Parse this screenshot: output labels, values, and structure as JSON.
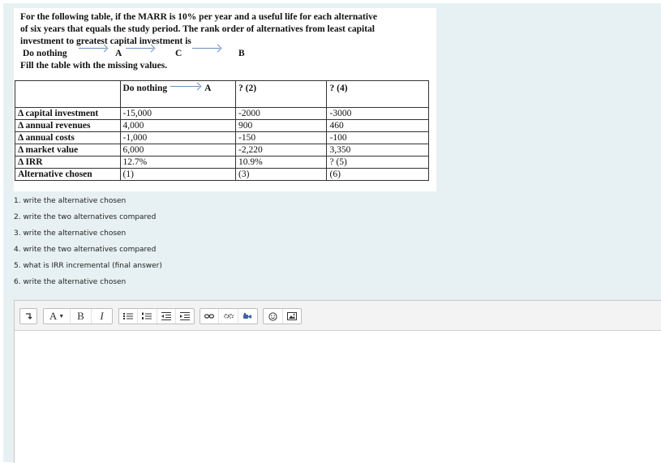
{
  "question": {
    "line1": "For the following table, if the MARR is 10% per year and a useful life for each alternative",
    "line2": "of six years that equals the study period. The rank order of alternatives from least capital",
    "line3": "investment to greatest capital investment is",
    "rank": [
      "Do nothing",
      "A",
      "C",
      "B"
    ],
    "instruction": "Fill the table with the missing values."
  },
  "table": {
    "header": {
      "col1_left": "Do nothing",
      "col1_right": "A",
      "col2": "? (2)",
      "col3": "? (4)"
    },
    "rows": [
      {
        "label": "Δ capital investment",
        "c1": "-15,000",
        "c2": "-2000",
        "c3": "-3000"
      },
      {
        "label": "Δ annual  revenues",
        "c1": "4,000",
        "c2": "900",
        "c3": "460"
      },
      {
        "label": "Δ annual costs",
        "c1": "-1,000",
        "c2": "-150",
        "c3": "-100"
      },
      {
        "label": "Δ market value",
        "c1": "6,000",
        "c2": "-2,220",
        "c3": "3,350"
      },
      {
        "label": "Δ IRR",
        "c1": "12.7%",
        "c2": "10.9%",
        "c3": "? (5)"
      },
      {
        "label": "Alternative chosen",
        "c1": "(1)",
        "c2": "(3)",
        "c3": "(6)"
      }
    ]
  },
  "notes": [
    "1. write the alternative chosen",
    "2. write the two alternatives compared",
    "3. write the alternative chosen",
    "4. write the two alternatives compared",
    "5. what is IRR incremental (final answer)",
    "6. write the alternative chosen"
  ],
  "toolbar": {
    "font_label": "A",
    "bold_label": "B",
    "italic_label": "I"
  },
  "colors": {
    "panel_bg": "#e7f1f3",
    "arrow": "#6a8fc0",
    "icon_blue": "#3a63a8"
  }
}
